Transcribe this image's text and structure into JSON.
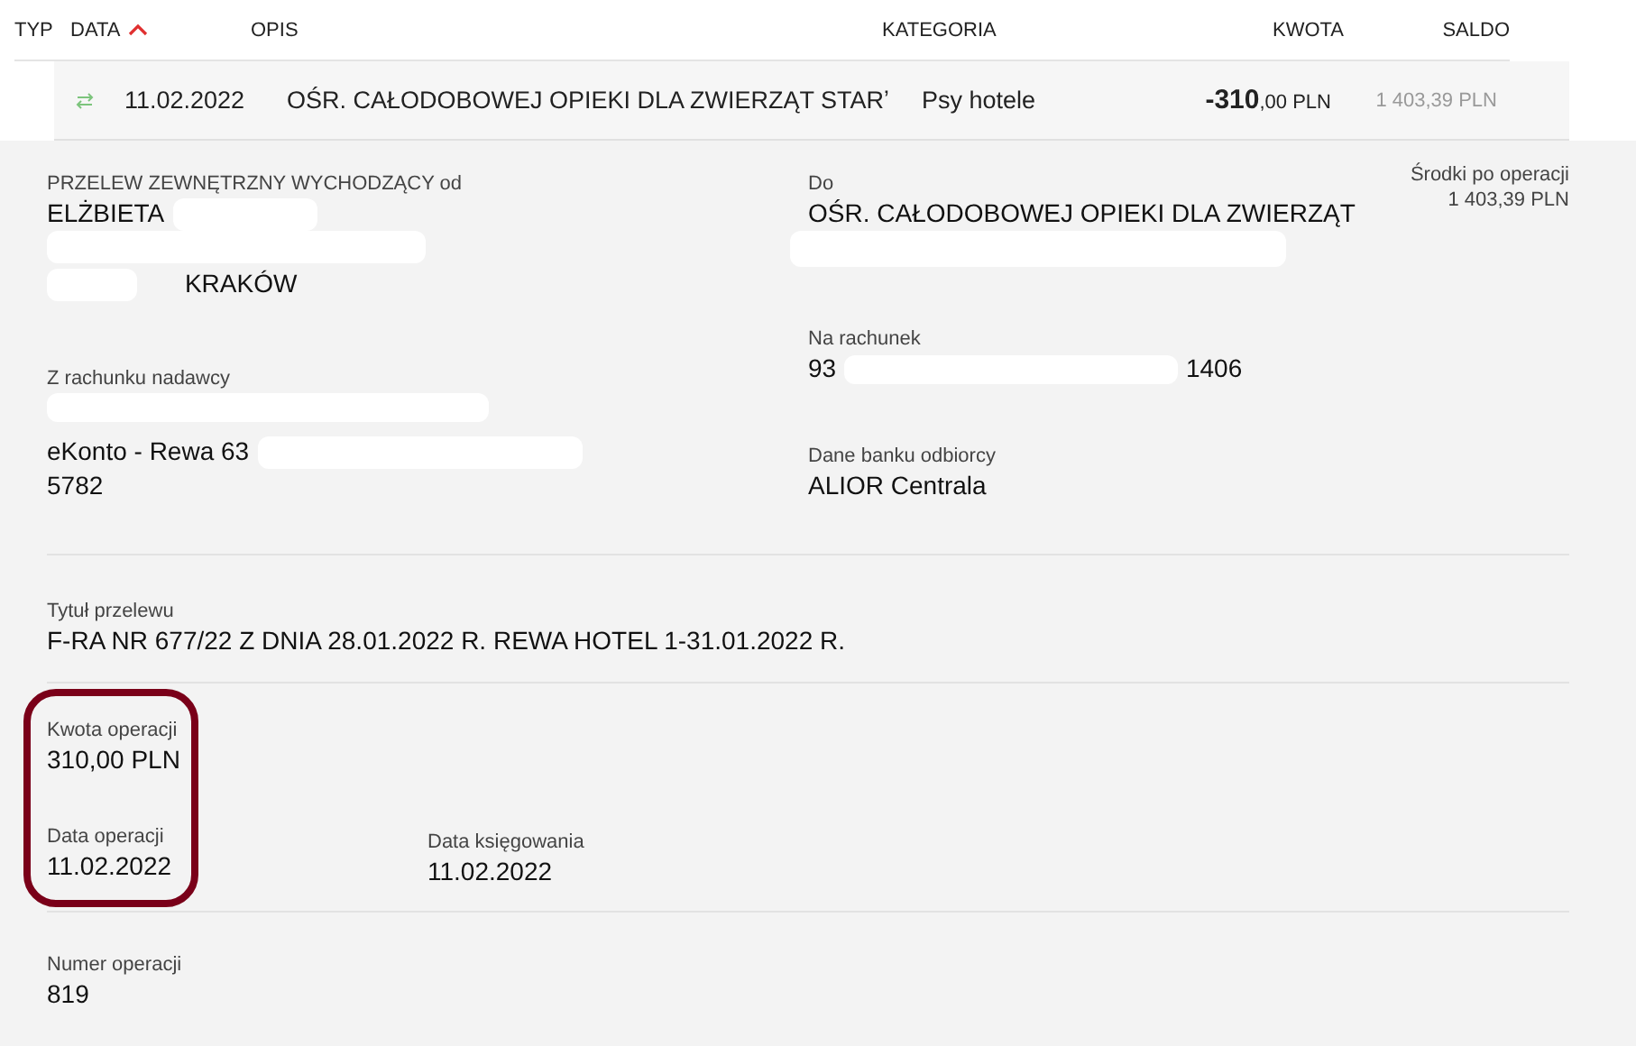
{
  "table": {
    "columns": [
      {
        "label": "TYP",
        "sorted": false
      },
      {
        "label": "DATA",
        "sorted": true
      },
      {
        "label": "OPIS",
        "sorted": false
      },
      {
        "label": "KATEGORIA",
        "sorted": false
      },
      {
        "label": "KWOTA",
        "sorted": false
      },
      {
        "label": "SALDO",
        "sorted": false
      }
    ],
    "row": {
      "date": "11.02.2022",
      "description": "OŚR. CAŁODOBOWEJ OPIEKI DLA ZWIERZĄT STARʼ",
      "category": "Psy hotele",
      "amount_main": "-310",
      "amount_rest": ",00 PLN",
      "balance": "1 403,39 PLN"
    }
  },
  "details": {
    "sender_label": "PRZELEW ZEWNĘTRZNY WYCHODZĄCY od",
    "sender_name": "ELŻBIETA",
    "sender_city": "KRAKÓW",
    "from_account_label": "Z rachunku nadawcy",
    "from_account_name": "eKonto - Rewa 63",
    "from_account_end": "5782",
    "recipient_label": "Do",
    "recipient_name": "OŚR. CAŁODOBOWEJ OPIEKI DLA ZWIERZĄT",
    "to_account_label": "Na rachunek",
    "to_account_start": "93",
    "to_account_end": "1406",
    "bank_label": "Dane banku odbiorcy",
    "bank_name": "ALIOR Centrala",
    "funds_label": "Środki po operacji",
    "funds_value": "1 403,39 PLN",
    "title_label": "Tytuł przelewu",
    "title_value": "F-RA NR 677/22 Z DNIA 28.01.2022 R. REWA HOTEL 1-31.01.2022 R.",
    "amount_label": "Kwota operacji",
    "amount_value": "310,00 PLN",
    "op_date_label": "Data operacji",
    "op_date_value": "11.02.2022",
    "book_date_label": "Data księgowania",
    "book_date_value": "11.02.2022",
    "number_label": "Numer operacji",
    "number_value": "819"
  }
}
